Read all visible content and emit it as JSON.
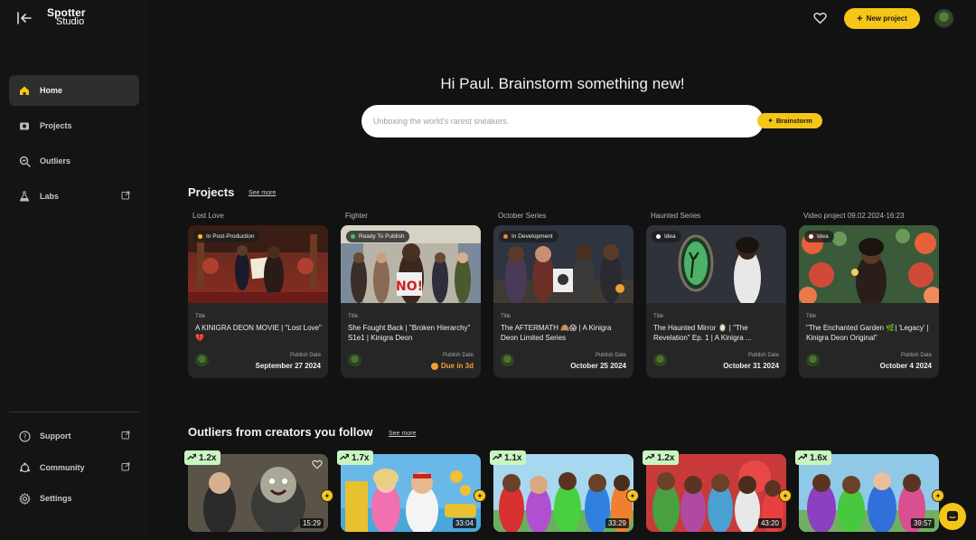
{
  "app": {
    "logo_line1": "Spotter",
    "logo_line2": "Studio"
  },
  "sidebar": {
    "items": [
      {
        "label": "Home",
        "icon": "home-icon"
      },
      {
        "label": "Projects",
        "icon": "projects-icon"
      },
      {
        "label": "Outliers",
        "icon": "outliers-icon"
      },
      {
        "label": "Labs",
        "icon": "labs-icon"
      }
    ],
    "bottom": [
      {
        "label": "Support",
        "icon": "support-icon"
      },
      {
        "label": "Community",
        "icon": "community-icon"
      },
      {
        "label": "Settings",
        "icon": "settings-icon"
      }
    ]
  },
  "header": {
    "new_project_label": "New project"
  },
  "hero": {
    "greeting": "Hi Paul. Brainstorm something new!",
    "search_placeholder": "Unboxing the world's rarest sneakers.",
    "brainstorm_label": "Brainstorm"
  },
  "projects": {
    "title": "Projects",
    "see_more": "See more",
    "title_label": "Title",
    "publish_label": "Publish Date",
    "cards": [
      {
        "series": "Lost Love",
        "status": "In Post-Production",
        "status_color": "#f5c518",
        "title": "A KINIGRA DEON MOVIE | \"Lost Love\" 💔",
        "date": "September 27 2024"
      },
      {
        "series": "Fighter",
        "status": "Ready To Publish",
        "status_color": "#3cc46a",
        "title": "She Fought Back | \"Broken Hierarchy\" S1e1 | Kinigra Deon",
        "date": "Due in 3d"
      },
      {
        "series": "October Series",
        "status": "In Development",
        "status_color": "#f08a30",
        "title": "The AFTERMATH 🙈😱 | A Kinigra Deon Limited Series",
        "date": "October 25 2024"
      },
      {
        "series": "Haunted Series",
        "status": "Idea",
        "status_color": "#ffffff",
        "title": "The Haunted Mirror 🪞 | \"The Revelation\" Ep. 1 | A Kinigra ...",
        "date": "October 31 2024"
      },
      {
        "series": "Video project 09.02.2024-16:23",
        "status": "Idea",
        "status_color": "#ffffff",
        "title": "\"The Enchanted Garden 🌿| 'Legacy' | Kinigra Deon Original\"",
        "date": "October 4 2024"
      }
    ]
  },
  "outliers": {
    "title": "Outliers from creators you follow",
    "see_more": "See more",
    "cards": [
      {
        "multiplier": "1.2x",
        "duration": "15:29"
      },
      {
        "multiplier": "1.7x",
        "duration": "33:04"
      },
      {
        "multiplier": "1.1x",
        "duration": "33:29"
      },
      {
        "multiplier": "1.2x",
        "duration": "43:20"
      },
      {
        "multiplier": "1.6x",
        "duration": "39:57"
      }
    ]
  },
  "colors": {
    "accent": "#f5c518",
    "bg": "#121212",
    "card": "#262626",
    "badge": "#c8f5c0"
  }
}
